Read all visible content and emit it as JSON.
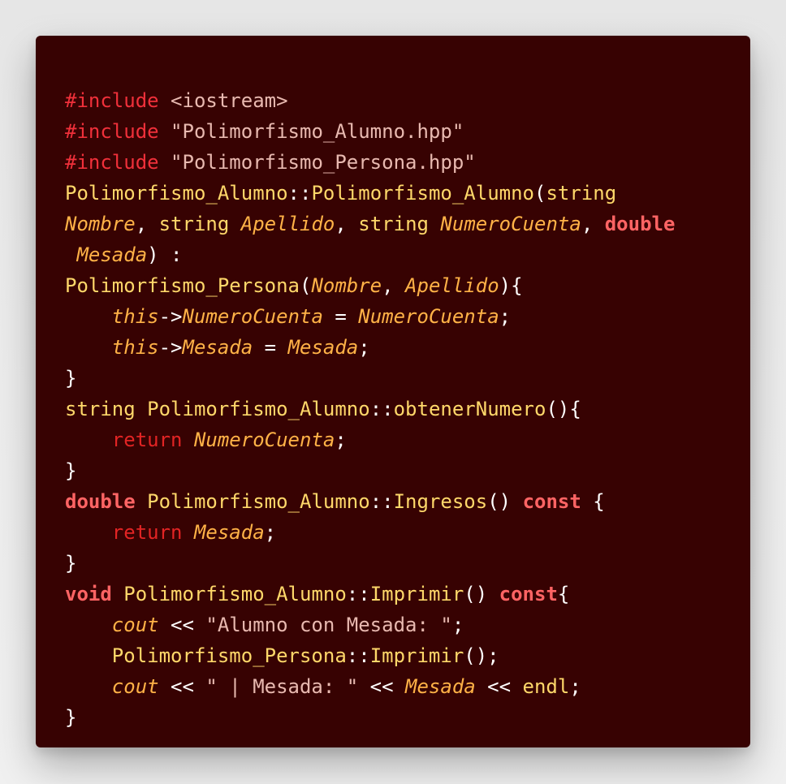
{
  "code": {
    "lines": [
      [
        [
          "pp",
          "#include"
        ],
        [
          "pl",
          " "
        ],
        [
          "str",
          "<iostream>"
        ]
      ],
      [
        [
          "pp",
          "#include"
        ],
        [
          "pl",
          " "
        ],
        [
          "str",
          "\"Polimorfismo_Alumno.hpp\""
        ]
      ],
      [
        [
          "pp",
          "#include"
        ],
        [
          "pl",
          " "
        ],
        [
          "str",
          "\"Polimorfismo_Persona.hpp\""
        ]
      ],
      [
        [
          "fn",
          "Polimorfismo_Alumno"
        ],
        [
          "pl",
          "::"
        ],
        [
          "fn",
          "Polimorfismo_Alumno"
        ],
        [
          "pl",
          "("
        ],
        [
          "ty",
          "string"
        ]
      ],
      [
        [
          "it",
          "Nombre"
        ],
        [
          "pl",
          ", "
        ],
        [
          "ty",
          "string "
        ],
        [
          "it",
          "Apellido"
        ],
        [
          "pl",
          ", "
        ],
        [
          "ty",
          "string "
        ],
        [
          "it",
          "NumeroCuenta"
        ],
        [
          "pl",
          ", "
        ],
        [
          "kw",
          "double"
        ]
      ],
      [
        [
          "pl",
          " "
        ],
        [
          "it",
          "Mesada"
        ],
        [
          "pl",
          ") :"
        ]
      ],
      [
        [
          "fn",
          "Polimorfismo_Persona"
        ],
        [
          "pl",
          "("
        ],
        [
          "it",
          "Nombre"
        ],
        [
          "pl",
          ", "
        ],
        [
          "it",
          "Apellido"
        ],
        [
          "pl",
          "){"
        ]
      ],
      [
        [
          "pl",
          "    "
        ],
        [
          "it",
          "this"
        ],
        [
          "pl",
          "->"
        ],
        [
          "it",
          "NumeroCuenta"
        ],
        [
          "pl",
          " = "
        ],
        [
          "it",
          "NumeroCuenta"
        ],
        [
          "pl",
          ";"
        ]
      ],
      [
        [
          "pl",
          "    "
        ],
        [
          "it",
          "this"
        ],
        [
          "pl",
          "->"
        ],
        [
          "it",
          "Mesada"
        ],
        [
          "pl",
          " = "
        ],
        [
          "it",
          "Mesada"
        ],
        [
          "pl",
          ";"
        ]
      ],
      [
        [
          "pl",
          "}"
        ]
      ],
      [
        [
          "ty",
          "string "
        ],
        [
          "fn",
          "Polimorfismo_Alumno"
        ],
        [
          "pl",
          "::"
        ],
        [
          "fn",
          "obtenerNumero"
        ],
        [
          "pl",
          "(){"
        ]
      ],
      [
        [
          "pl",
          "    "
        ],
        [
          "rkw",
          "return "
        ],
        [
          "it",
          "NumeroCuenta"
        ],
        [
          "pl",
          ";"
        ]
      ],
      [
        [
          "pl",
          "}"
        ]
      ],
      [
        [
          "kw",
          "double "
        ],
        [
          "fn",
          "Polimorfismo_Alumno"
        ],
        [
          "pl",
          "::"
        ],
        [
          "fn",
          "Ingresos"
        ],
        [
          "pl",
          "() "
        ],
        [
          "kw",
          "const"
        ],
        [
          "pl",
          " {"
        ]
      ],
      [
        [
          "pl",
          "    "
        ],
        [
          "rkw",
          "return "
        ],
        [
          "it",
          "Mesada"
        ],
        [
          "pl",
          ";"
        ]
      ],
      [
        [
          "pl",
          "}"
        ]
      ],
      [
        [
          "kw",
          "void "
        ],
        [
          "fn",
          "Polimorfismo_Alumno"
        ],
        [
          "pl",
          "::"
        ],
        [
          "fn",
          "Imprimir"
        ],
        [
          "pl",
          "() "
        ],
        [
          "kw",
          "const"
        ],
        [
          "pl",
          "{"
        ]
      ],
      [
        [
          "pl",
          "    "
        ],
        [
          "it",
          "cout"
        ],
        [
          "pl",
          " << "
        ],
        [
          "lit",
          "\"Alumno con Mesada: \""
        ],
        [
          "pl",
          ";"
        ]
      ],
      [
        [
          "pl",
          "    "
        ],
        [
          "fn",
          "Polimorfismo_Persona"
        ],
        [
          "pl",
          "::"
        ],
        [
          "fn",
          "Imprimir"
        ],
        [
          "pl",
          "();"
        ]
      ],
      [
        [
          "pl",
          "    "
        ],
        [
          "it",
          "cout"
        ],
        [
          "pl",
          " << "
        ],
        [
          "lit",
          "\" | Mesada: \""
        ],
        [
          "pl",
          " << "
        ],
        [
          "it",
          "Mesada"
        ],
        [
          "pl",
          " << "
        ],
        [
          "ty",
          "endl"
        ],
        [
          "pl",
          ";"
        ]
      ],
      [
        [
          "pl",
          "}"
        ]
      ]
    ]
  }
}
